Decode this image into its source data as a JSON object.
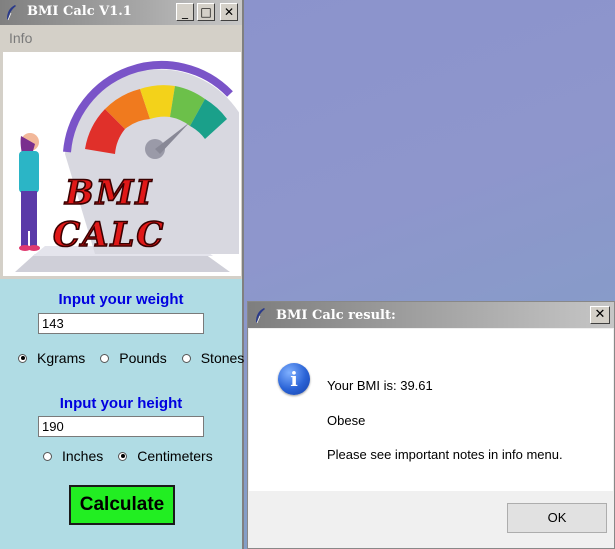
{
  "main_window": {
    "title": "BMI Calc V1.1",
    "controls": {
      "minimize": "_",
      "maximize": "□",
      "close": "✕"
    },
    "menu": {
      "info": "Info"
    },
    "logo_text": [
      "BMI",
      "CALC"
    ],
    "weight": {
      "heading": "Input your weight",
      "value": "143",
      "units": [
        {
          "label": "Kgrams",
          "selected": true
        },
        {
          "label": "Pounds",
          "selected": false
        },
        {
          "label": "Stones",
          "selected": false
        }
      ]
    },
    "height": {
      "heading": "Input your height",
      "value": "190",
      "units": [
        {
          "label": "Inches",
          "selected": false
        },
        {
          "label": "Centimeters",
          "selected": true
        }
      ]
    },
    "calculate_label": "Calculate"
  },
  "result_dialog": {
    "title": "BMI Calc result:",
    "close": "✕",
    "icon": "info-icon",
    "lines": [
      "Your BMI is: 39.61",
      "Obese",
      "Please see important notes in info menu."
    ],
    "ok_label": "OK"
  },
  "colors": {
    "panel": "#b0dce4",
    "heading": "#0000e0",
    "calculate": "#22ee22",
    "desktop": "#8a92cc"
  }
}
